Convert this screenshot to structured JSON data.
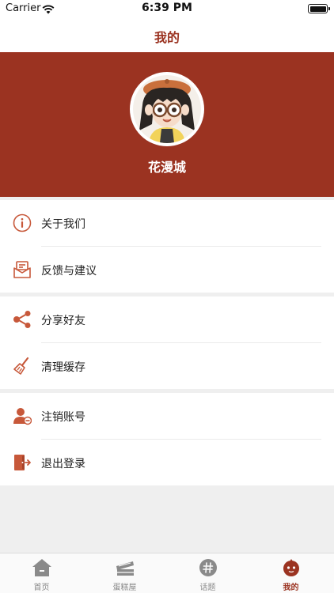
{
  "status_bar": {
    "carrier": "Carrier",
    "time": "6:39 PM"
  },
  "nav": {
    "title": "我的"
  },
  "profile": {
    "name": "花漫城"
  },
  "menu": {
    "about": "关于我们",
    "feedback": "反馈与建议",
    "share": "分享好友",
    "clear_cache": "清理缓存",
    "delete_account": "注销账号",
    "logout": "退出登录"
  },
  "tabs": [
    {
      "label": "首页",
      "icon": "home-icon"
    },
    {
      "label": "蛋糕屋",
      "icon": "cake-icon"
    },
    {
      "label": "话题",
      "icon": "hashtag-icon"
    },
    {
      "label": "我的",
      "icon": "profile-face-icon"
    }
  ],
  "colors": {
    "accent": "#9b3321",
    "icon": "#c7583a",
    "background": "#efefef"
  }
}
